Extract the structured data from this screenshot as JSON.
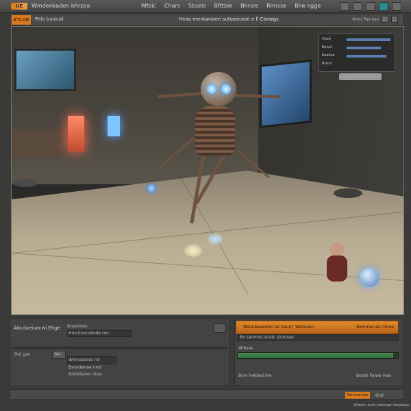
{
  "app": {
    "logo_text": "UE",
    "title": "Wmdenkaden bhrpsa",
    "menu": [
      "Wtsic",
      "Chars",
      "Sbseis",
      "Bfttbie",
      "Bhrsre",
      "Rimsse",
      "Bhe ngge"
    ]
  },
  "toolbar": {
    "icons": [
      "settings-icon",
      "window-icon",
      "grid-icon",
      "eye-icon",
      "close-icon"
    ]
  },
  "subbar": {
    "tab_active": "BTCAR",
    "tab_second": "Pelo basicid",
    "viewport_title": "Heav mentwoaen sutosecooe a ll Coowgs",
    "right_label": "Hnm Pas sou"
  },
  "overlay": {
    "rows": [
      "Hpee",
      "Bonaf",
      "Roadsa",
      "Brsnd"
    ]
  },
  "details_panel": {
    "title": "Abcdaeiuacwi Ehge",
    "row1_label": "Bneaimes",
    "row1_value": "Hno bnecabnde mo",
    "row2_label": "Slet gas",
    "row2_button": "Mo",
    "list": [
      "Wrenaesoss nd",
      "Bsnnitenae nnd",
      "Bdrddianor ntee"
    ]
  },
  "render_panel": {
    "header_left": "Wsnobeaeutor lar baunt",
    "header_mid": "Wstwaun",
    "header_right": "Remmecusn Dnoe",
    "sub_label": "Bo sanmos lusstc siuntsse",
    "status_label": "Wlbsas",
    "progress": 0.97,
    "footer_left": "Bom loebesl rhe",
    "footer_right": "Beoet Paiwo reas"
  },
  "bottom_bar": {
    "button_label": "Ramene bac",
    "button_right": "Bnd"
  },
  "footer_note": "Wntocu suds amnusar neuwinas",
  "colors": {
    "accent": "#d9791d",
    "background": "#3b3b3a",
    "panel": "#434342",
    "progress": "#4a8a52"
  }
}
